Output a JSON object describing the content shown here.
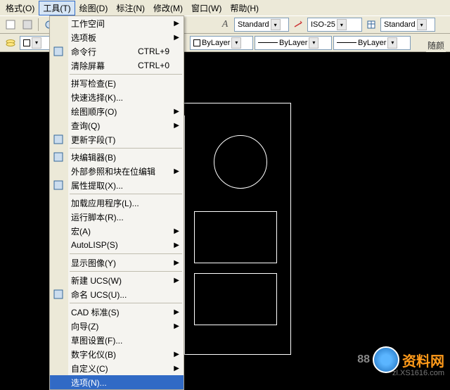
{
  "menubar": {
    "items": [
      {
        "label": "格式(O)"
      },
      {
        "label": "工具(T)",
        "active": true
      },
      {
        "label": "绘图(D)"
      },
      {
        "label": "标注(N)"
      },
      {
        "label": "修改(M)"
      },
      {
        "label": "窗口(W)"
      },
      {
        "label": "帮助(H)"
      }
    ]
  },
  "toolbar1": {
    "style1": "Standard",
    "dimstyle": "ISO-25",
    "tablestyle": "Standard"
  },
  "toolbar2": {
    "layer1": "ByLayer",
    "layer2": "ByLayer",
    "layer3": "ByLayer",
    "right_label": "随颜"
  },
  "dropdown": {
    "items": [
      {
        "label": "工作空间",
        "sub": true
      },
      {
        "label": "选项板",
        "sub": true
      },
      {
        "label": "命令行",
        "shortcut": "CTRL+9",
        "icon": "cmd"
      },
      {
        "label": "清除屏幕",
        "shortcut": "CTRL+0"
      },
      {
        "sep": true
      },
      {
        "label": "拼写检查(E)"
      },
      {
        "label": "快速选择(K)..."
      },
      {
        "label": "绘图顺序(O)",
        "sub": true
      },
      {
        "label": "查询(Q)",
        "sub": true
      },
      {
        "label": "更新字段(T)",
        "icon": "refresh"
      },
      {
        "sep": true
      },
      {
        "label": "块编辑器(B)",
        "icon": "block"
      },
      {
        "label": "外部参照和块在位编辑",
        "sub": true
      },
      {
        "label": "属性提取(X)...",
        "icon": "attr"
      },
      {
        "sep": true
      },
      {
        "label": "加载应用程序(L)..."
      },
      {
        "label": "运行脚本(R)..."
      },
      {
        "label": "宏(A)",
        "sub": true
      },
      {
        "label": "AutoLISP(S)",
        "sub": true
      },
      {
        "sep": true
      },
      {
        "label": "显示图像(Y)",
        "sub": true
      },
      {
        "sep": true
      },
      {
        "label": "新建 UCS(W)",
        "sub": true
      },
      {
        "label": "命名 UCS(U)...",
        "icon": "ucs"
      },
      {
        "sep": true
      },
      {
        "label": "CAD 标准(S)",
        "sub": true
      },
      {
        "label": "向导(Z)",
        "sub": true
      },
      {
        "label": "草图设置(F)..."
      },
      {
        "label": "数字化仪(B)",
        "sub": true
      },
      {
        "label": "自定义(C)",
        "sub": true
      },
      {
        "label": "选项(N)...",
        "selected": true
      }
    ]
  },
  "footer": {
    "brand": "资料网",
    "url": "zl.XS1616.com",
    "digits": "88"
  }
}
